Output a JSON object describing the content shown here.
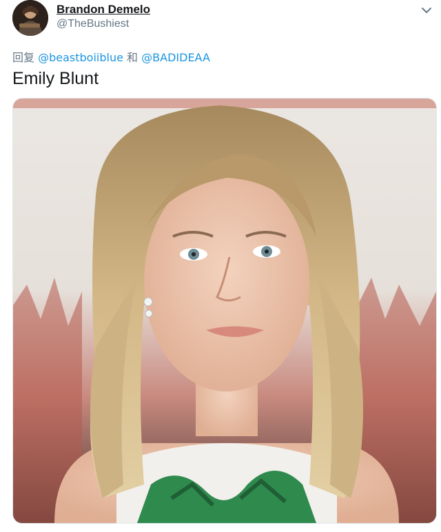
{
  "author": {
    "name": "Brandon Demelo",
    "handle": "@TheBushiest",
    "avatar_icon": "profile-avatar"
  },
  "reply": {
    "prefix": "回复",
    "mention1": "@beastboiiblue",
    "conjunction": "和",
    "mention2": "@BADIDEAA"
  },
  "tweet": {
    "text": "Emily Blunt",
    "media_icon": "portrait-photo"
  },
  "menu": {
    "icon": "chevron-down-icon"
  },
  "colors": {
    "link": "#1b95e0",
    "secondary": "#657786",
    "text": "#14171a"
  }
}
